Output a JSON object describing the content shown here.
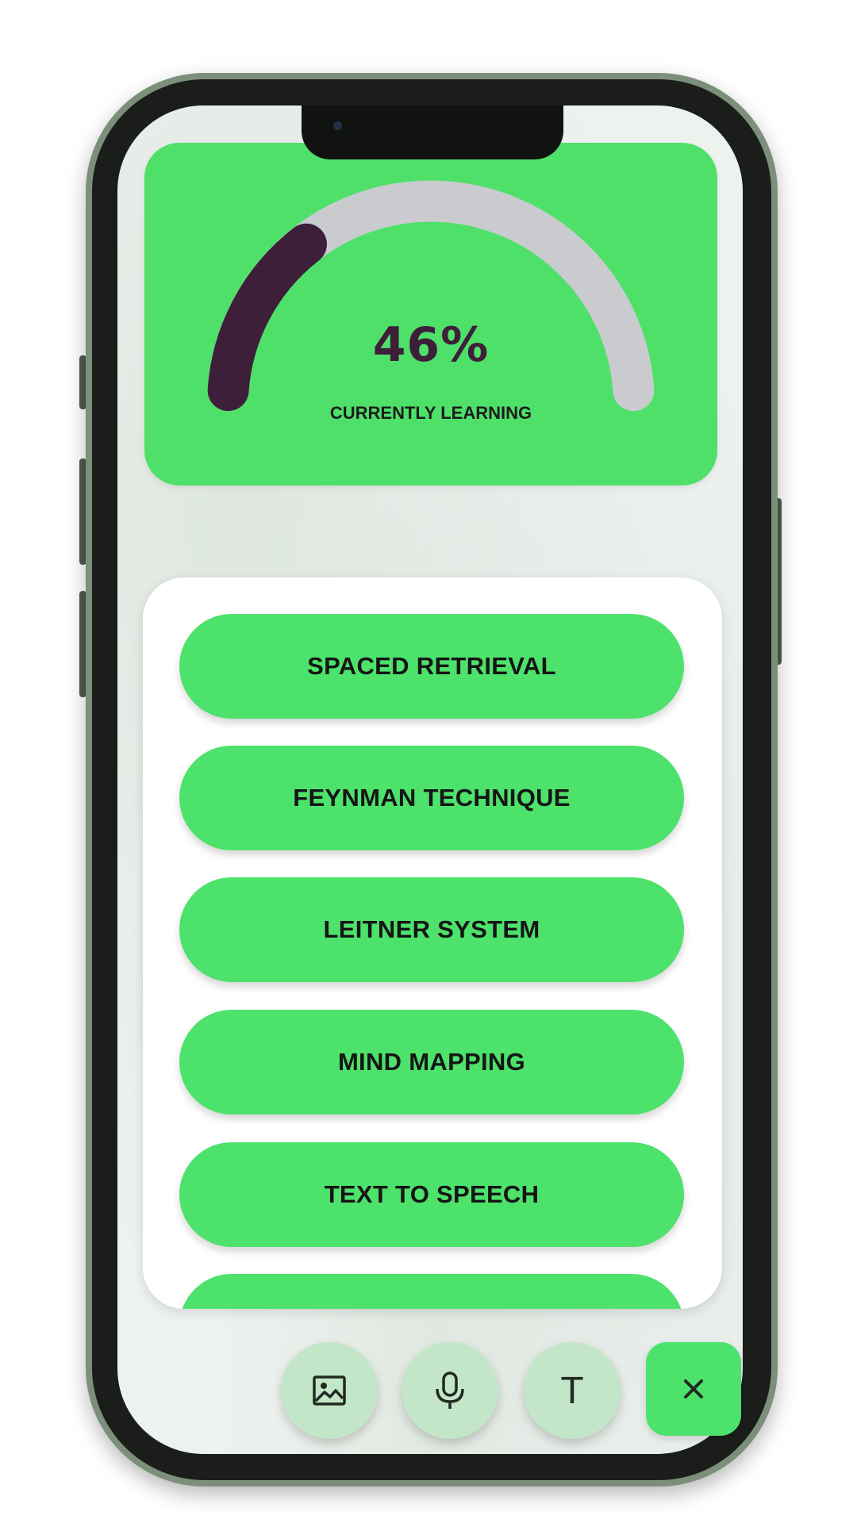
{
  "gauge": {
    "percent_label": "46%",
    "progress_fraction": 0.28,
    "caption": "CURRENTLY LEARNING",
    "track_color": "#c9cbcf",
    "fill_color": "#3d1f3a",
    "card_color": "#4fe06a"
  },
  "techniques": {
    "items": [
      {
        "label": "SPACED RETRIEVAL"
      },
      {
        "label": "FEYNMAN TECHNIQUE"
      },
      {
        "label": "LEITNER SYSTEM"
      },
      {
        "label": "MIND MAPPING"
      },
      {
        "label": "TEXT TO SPEECH"
      }
    ],
    "button_color": "#4ce26b"
  },
  "actions": {
    "image_icon": "image-icon",
    "mic_icon": "microphone-icon",
    "text_icon_glyph": "T",
    "close_icon": "close-icon",
    "fab_color": "#c4e6c8"
  }
}
